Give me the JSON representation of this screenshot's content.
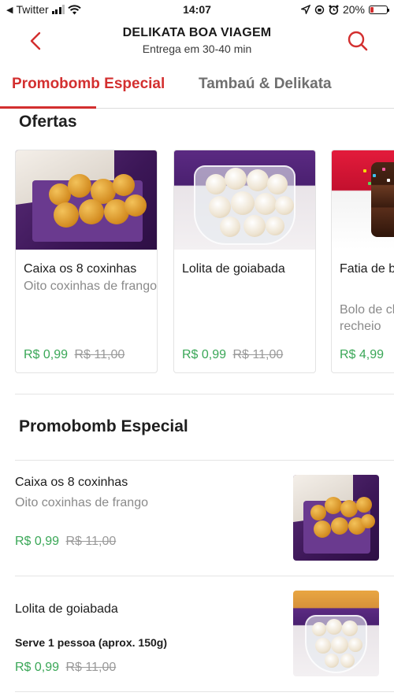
{
  "status_bar": {
    "carrier": "Twitter",
    "time": "14:07",
    "battery": "20%"
  },
  "header": {
    "store_name": "DELIKATA BOA VIAGEM",
    "delivery_time": "Entrega em 30-40 min",
    "back_icon": "chevron-left-icon",
    "search_icon": "search-icon"
  },
  "tabs": [
    {
      "label": "Promobomb Especial",
      "active": true
    },
    {
      "label": "Tambaú & Delikata",
      "active": false
    }
  ],
  "offers": {
    "title": "Ofertas",
    "items": [
      {
        "name": "Caixa os 8 coxinhas",
        "description": "Oito coxinhas de frango",
        "price": "R$ 0,99",
        "old_price": "R$ 11,00"
      },
      {
        "name": "Lolita de goiabada",
        "description": "",
        "price": "R$ 0,99",
        "old_price": "R$ 11,00"
      },
      {
        "name": "Fatia de bolo feliz",
        "description": "Bolo de chocolate com recheio",
        "price": "R$ 4,99",
        "old_price": ""
      }
    ]
  },
  "section": {
    "title": "Promobomb Especial",
    "items": [
      {
        "name": "Caixa os 8 coxinhas",
        "description": "Oito coxinhas de frango",
        "serves": "",
        "price": "R$ 0,99",
        "old_price": "R$ 11,00"
      },
      {
        "name": "Lolita de goiabada",
        "description": "",
        "serves": "Serve 1 pessoa (aprox. 150g)",
        "price": "R$ 0,99",
        "old_price": "R$ 11,00"
      }
    ]
  },
  "colors": {
    "accent": "#d32f2f",
    "price": "#3aa757",
    "muted": "#8a8a8a"
  }
}
